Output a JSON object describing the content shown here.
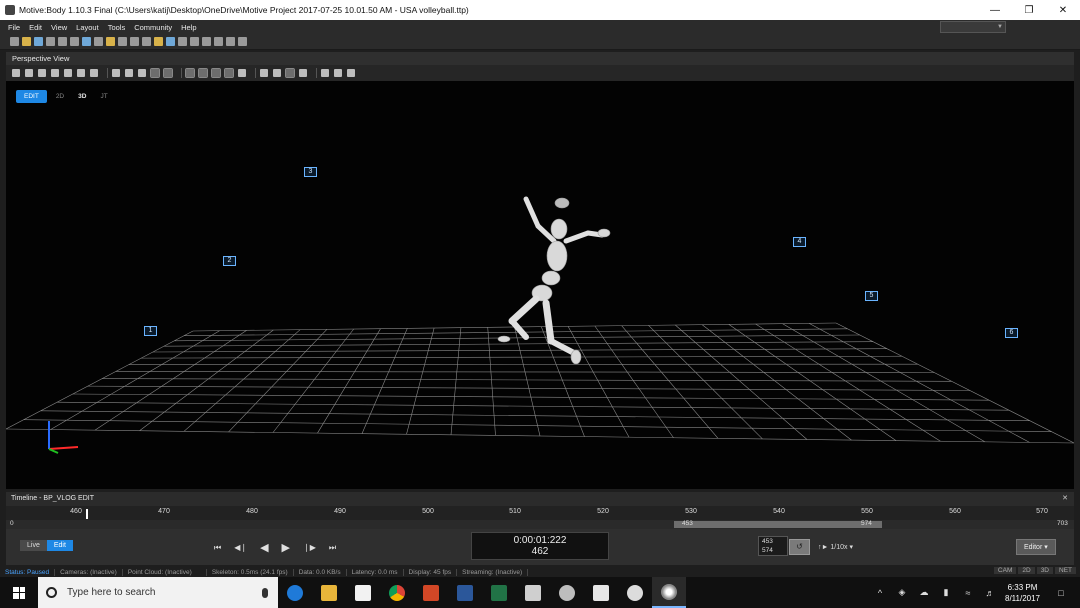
{
  "window": {
    "title": "Motive:Body 1.10.3 Final (C:\\Users\\katij\\Desktop\\OneDrive\\Motive Project 2017-07-25 10.01.50 AM - USA volleyball.ttp)",
    "minimize_icon": "minimize-icon",
    "restore_icon": "restore-icon",
    "close_icon": "close-icon"
  },
  "menu": [
    "File",
    "Edit",
    "View",
    "Layout",
    "Tools",
    "Community",
    "Help"
  ],
  "perspective_view": {
    "title": "Perspective View",
    "modes": [
      "EDIT",
      "2D",
      "3D",
      "JT"
    ],
    "camera_labels": [
      "1",
      "2",
      "3",
      "4",
      "5",
      "6"
    ]
  },
  "timeline": {
    "title": "Timeline - BP_VLOG EDIT",
    "ticks": [
      "460",
      "470",
      "480",
      "490",
      "500",
      "510",
      "520",
      "530",
      "540",
      "550",
      "560",
      "570"
    ],
    "range_start": "0",
    "range_end": "703",
    "selection_start": "453",
    "selection_end": "574",
    "live_label": "Live",
    "edit_label": "Edit",
    "timecode": "0:00:01:222",
    "frame": "462",
    "range_box_start": "453",
    "range_box_end": "574",
    "speed": "1/10x",
    "editor_button": "Editor",
    "current_frame": 462
  },
  "status": {
    "status_label": "Status:",
    "status_value": "Paused",
    "cameras": "Cameras: (Inactive)",
    "point_cloud": "Point Cloud: (Inactive)",
    "skeleton": "Skeleton: 0.5ms (24.1 fps)",
    "data": "Data: 0.0 KB/s",
    "latency": "Latency: 0.0 ms",
    "display": "Display: 45 fps",
    "streaming": "Streaming: (Inactive)",
    "tabs": [
      "CAM",
      "2D",
      "3D",
      "NET"
    ]
  },
  "taskbar": {
    "search_placeholder": "Type here to search",
    "time": "6:33 PM",
    "date": "8/11/2017",
    "apps": [
      "edge-icon",
      "file-explorer-icon",
      "store-icon",
      "chrome-icon",
      "powerpoint-icon",
      "word-icon",
      "excel-icon",
      "calculator-icon",
      "network-icon",
      "mail-icon",
      "media-icon",
      "motive-icon"
    ]
  },
  "colors": {
    "accent": "#1e88e5",
    "camera_outline": "#6ab4ff",
    "viewport_bg": "#030303"
  }
}
